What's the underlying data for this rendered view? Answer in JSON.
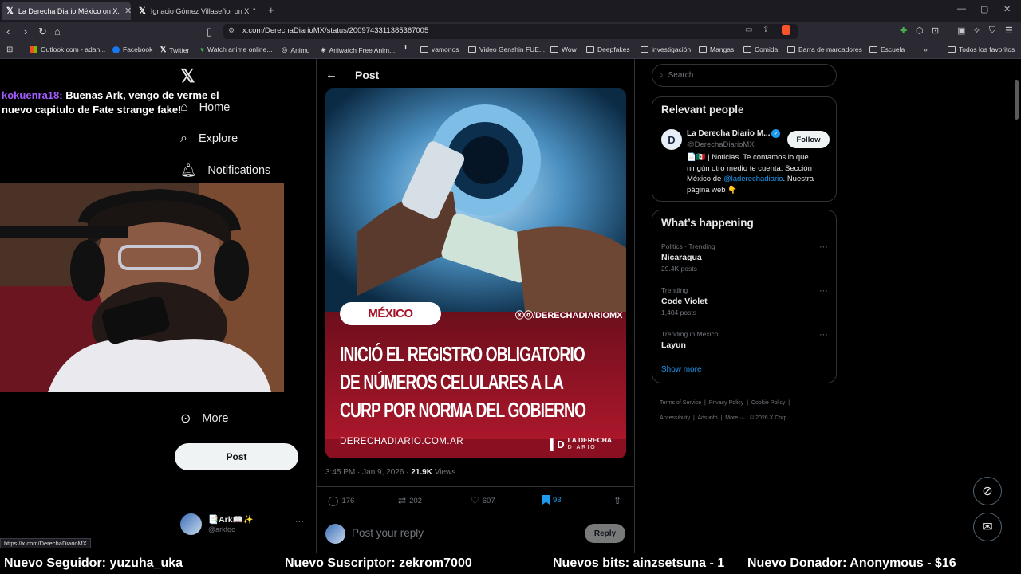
{
  "browser": {
    "tabs": [
      {
        "title": "La Derecha Diario México on X:",
        "active": true
      },
      {
        "title": "Ignacio Gómez Villaseñor on X: \"",
        "active": false
      }
    ],
    "url": "x.com/DerechaDiarioMX/status/2009743311385367005",
    "bookmarks": [
      "Outlook.com - adan...",
      "Facebook",
      "Twitter",
      "Watch anime online...",
      "Animu",
      "Aniwatch Free Anim...",
      "vamonos",
      "Video Genshin FUE...",
      "Wow",
      "Deepfakes",
      "investigación",
      "Mangas",
      "Comida",
      "Barra de marcadores",
      "Escuela"
    ],
    "bookmarks_all": "Todos los favoritos",
    "status_url": "https://x.com/DerechaDiarioMX"
  },
  "leftnav": {
    "items": [
      "Home",
      "Explore",
      "Notifications",
      "More"
    ],
    "post_button": "Post",
    "account_name": "📑Ark📖✨",
    "account_handle": "@arkfgo"
  },
  "chat": {
    "user": "kokuenra18:",
    "message": "Buenas Ark, vengo de verme el nuevo capitulo de Fate strange fake!"
  },
  "post": {
    "header": "Post",
    "image": {
      "tag": "MÉXICO",
      "handle": "ⓧⓞ/DERECHADIARIOMX",
      "headline_1": "INICIÓ EL REGISTRO OBLIGATORIO",
      "headline_2": "DE NÚMEROS CELULARES A LA",
      "headline_3": "CURP POR NORMA DEL GOBIERNO",
      "site": "DERECHADIARIO.COM.AR",
      "brand_1": "LA DERECHA",
      "brand_2": "DIARIO"
    },
    "time": "3:45 PM · Jan 9, 2026 · ",
    "views": "21.9K",
    "views_label": " Views",
    "replies": "176",
    "reposts": "202",
    "likes": "607",
    "bookmarks": "93",
    "reply_placeholder": "Post your reply",
    "reply_button": "Reply"
  },
  "right": {
    "search_placeholder": "Search",
    "relevant_title": "Relevant people",
    "person_name": "La Derecha Diario M...",
    "person_handle": "@DerechaDiarioMX",
    "follow": "Follow",
    "bio_1": "📄🇲🇽 | Noticias. Te contamos lo que",
    "bio_2": "ningún otro medio te cuenta. Sección",
    "bio_3a": "México de ",
    "bio_link": "@laderechadiario",
    "bio_3b": ". Nuestra",
    "bio_4": "página web 👇",
    "happening_title": "What’s happening",
    "trends": [
      {
        "sub": "Politics · Trending",
        "name": "Nicaragua",
        "count": "29.4K posts"
      },
      {
        "sub": "Trending",
        "name": "Code Violet",
        "count": "1,404 posts"
      },
      {
        "sub": "Trending in Mexico",
        "name": "Layun",
        "count": ""
      }
    ],
    "show_more": "Show more",
    "footer_1": [
      "Terms of Service",
      "Privacy Policy",
      "Cookie Policy"
    ],
    "footer_2": [
      "Accessibility",
      "Ads info",
      "More ···",
      "© 2026 X Corp."
    ]
  },
  "ticker": {
    "follower": "Nuevo Seguidor: yuzuha_uka",
    "subscriber": "Nuevo Suscriptor: zekrom7000",
    "bits": "Nuevos bits: ainzsetsuna - 1",
    "donor": "Nuevo Donador: Anonymous - $16"
  },
  "colors": {
    "accent": "#1d9bf0",
    "background": "#000000",
    "image_red": "#a5142a"
  }
}
